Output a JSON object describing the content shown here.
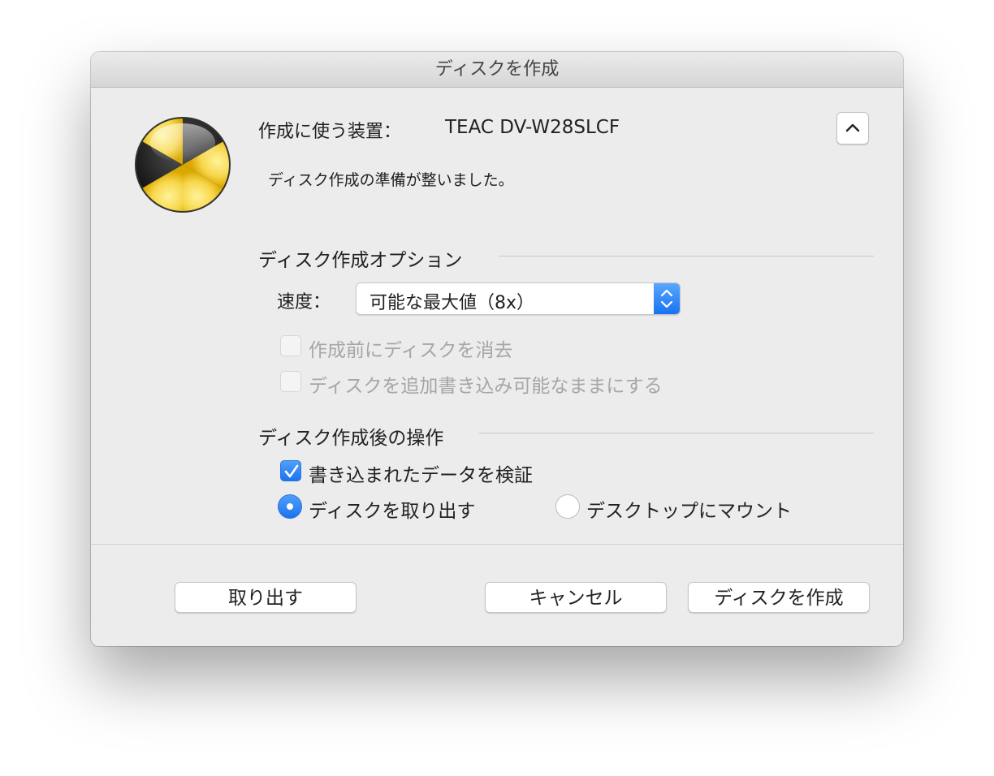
{
  "window": {
    "title": "ディスクを作成"
  },
  "device": {
    "label": "作成に使う装置：",
    "value": "TEAC DV-W28SLCF"
  },
  "status": "ディスク作成の準備が整いました。",
  "options": {
    "title": "ディスク作成オプション",
    "speed_label": "速度：",
    "speed_value": "可能な最大値（8x）",
    "erase_label": "作成前にディスクを消去",
    "erase_checked": false,
    "erase_enabled": false,
    "appendable_label": "ディスクを追加書き込み可能なままにする",
    "appendable_checked": false,
    "appendable_enabled": false
  },
  "after": {
    "title": "ディスク作成後の操作",
    "verify_label": "書き込まれたデータを検証",
    "verify_checked": true,
    "eject_label": "ディスクを取り出す",
    "mount_label": "デスクトップにマウント",
    "selected": "eject"
  },
  "buttons": {
    "eject": "取り出す",
    "cancel": "キャンセル",
    "burn": "ディスクを作成"
  },
  "colors": {
    "accent": "#1b73f0",
    "icon_yellow": "#f7d64a",
    "icon_black": "#222222"
  },
  "icons": {
    "app": "burn-radiation-icon",
    "collapse": "chevron-up-icon",
    "popup": "up-down-arrows-icon",
    "check": "checkmark-icon"
  }
}
